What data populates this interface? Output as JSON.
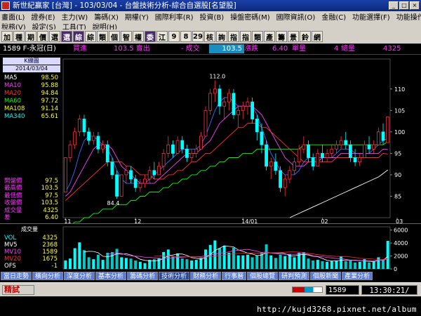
{
  "window": {
    "title": "新世紀贏家 [台灣] - 103/03/04 - 台盤技術分析-綜合自選股[名望股]"
  },
  "menubar": {
    "row1": [
      "畫面(L)",
      "證券(E)",
      "主力(W)",
      "籌碼(X)",
      "期權(Y)",
      "國際利率(R)",
      "投資(B)",
      "操盤密碼(M)",
      "國際資訊(O)",
      "金融(C)",
      "功能選擇(F)",
      "功能操作(P)"
    ],
    "row2": [
      "稅務(V)",
      "設定(S)",
      "工具(T)",
      "說明(H)"
    ]
  },
  "toolbar": {
    "buttons": [
      "加",
      "種",
      "期",
      "價",
      "選",
      "選",
      "綜",
      "綜",
      "類",
      "個",
      "智",
      "權",
      "委",
      "江",
      "9",
      "8",
      "29",
      "核",
      "詢",
      "指",
      "指",
      "類",
      "產",
      "籌",
      "景",
      "鈴",
      "網"
    ],
    "highlight_index": [
      5,
      6,
      12
    ]
  },
  "quote": {
    "stock": "1589 F-永冠(日)",
    "buy_label": "買進",
    "buy_value": "",
    "sell_label": "103.5 賣出",
    "change_label": "- 成交",
    "last_value": "103.5",
    "change_text": "漲跌",
    "change_value": "6.40",
    "unit_label": "單量",
    "unit_value": "4",
    "total_label": "總量",
    "total_value": "4325"
  },
  "indicator_panel": {
    "kline_label": "K線圖",
    "date": "2014/03/04",
    "mas": [
      {
        "name": "MA5",
        "value": "98.50",
        "color": "#ffffff"
      },
      {
        "name": "MA10",
        "value": "95.88",
        "color": "#ff3cff"
      },
      {
        "name": "MA20",
        "value": "94.84",
        "color": "#ff3030"
      },
      {
        "name": "MA60",
        "value": "97.72",
        "color": "#00ff00"
      },
      {
        "name": "MA108",
        "value": "91.14",
        "color": "#ffff00"
      },
      {
        "name": "MA340",
        "value": "65.61",
        "color": "#00ffff"
      }
    ],
    "prices": [
      {
        "name": "開盤價",
        "value": "97.5"
      },
      {
        "name": "最高價",
        "value": "103.5"
      },
      {
        "name": "最低價",
        "value": "97.5"
      },
      {
        "name": "收盤價",
        "value": "103.5"
      },
      {
        "name": "成交量",
        "value": "4325"
      },
      {
        "name": "差",
        "value": "6.40"
      }
    ]
  },
  "chart_data": {
    "type": "candlestick",
    "ylim": [
      80,
      117
    ],
    "yticks": [
      85,
      90,
      95,
      100,
      105,
      110
    ],
    "xticks": [
      {
        "index": 0,
        "label": "11"
      },
      {
        "index": 15,
        "label": "12"
      },
      {
        "index": 38,
        "label": "14/01"
      },
      {
        "index": 55,
        "label": "02"
      },
      {
        "index": 71,
        "label": "03"
      }
    ],
    "max_label": "112.0",
    "min_label": "84.4",
    "candles": [
      [
        86,
        94,
        86,
        94
      ],
      [
        94,
        98,
        93,
        97
      ],
      [
        97,
        101,
        96,
        100
      ],
      [
        100,
        104,
        99,
        103
      ],
      [
        103,
        104,
        99,
        100
      ],
      [
        100,
        101,
        97,
        98
      ],
      [
        98,
        100,
        97,
        99
      ],
      [
        99,
        100,
        95,
        96
      ],
      [
        96,
        98,
        95,
        97
      ],
      [
        97,
        98,
        92,
        93
      ],
      [
        93,
        94,
        89,
        90
      ],
      [
        90,
        91,
        84.4,
        85
      ],
      [
        85,
        90,
        85,
        90
      ],
      [
        90,
        92,
        88,
        91
      ],
      [
        91,
        92,
        88,
        89
      ],
      [
        89,
        90,
        86,
        87
      ],
      [
        87,
        89,
        86,
        88
      ],
      [
        88,
        90,
        87,
        89
      ],
      [
        89,
        92,
        88,
        91
      ],
      [
        91,
        93,
        89,
        90
      ],
      [
        90,
        93,
        90,
        92
      ],
      [
        92,
        96,
        91,
        95
      ],
      [
        95,
        99,
        94,
        97
      ],
      [
        97,
        98,
        94,
        95
      ],
      [
        95,
        99,
        95,
        98
      ],
      [
        98,
        99,
        95,
        96
      ],
      [
        96,
        97,
        93,
        94
      ],
      [
        94,
        96,
        93,
        95
      ],
      [
        95,
        97,
        94,
        96
      ],
      [
        96,
        100,
        96,
        99
      ],
      [
        99,
        106,
        99,
        105
      ],
      [
        105,
        110,
        104,
        109
      ],
      [
        109,
        112,
        107,
        110
      ],
      [
        110,
        111,
        104,
        106
      ],
      [
        106,
        108,
        103,
        107
      ],
      [
        107,
        110,
        105,
        109
      ],
      [
        109,
        110,
        103,
        104
      ],
      [
        104,
        106,
        101,
        105
      ],
      [
        105,
        107,
        103,
        106
      ],
      [
        106,
        108,
        104,
        107
      ],
      [
        107,
        108,
        102,
        103
      ],
      [
        103,
        104,
        98,
        100
      ],
      [
        100,
        102,
        95,
        97
      ],
      [
        97,
        98,
        91,
        92
      ],
      [
        92,
        94,
        89,
        93
      ],
      [
        93,
        95,
        90,
        91
      ],
      [
        91,
        92,
        86,
        87
      ],
      [
        87,
        90,
        85,
        89
      ],
      [
        89,
        92,
        88,
        91
      ],
      [
        91,
        94,
        90,
        93
      ],
      [
        93,
        97,
        92,
        96
      ],
      [
        96,
        99,
        95,
        97
      ],
      [
        97,
        98,
        93,
        94
      ],
      [
        94,
        95,
        91,
        92
      ],
      [
        92,
        96,
        92,
        95
      ],
      [
        95,
        97,
        93,
        94
      ],
      [
        94,
        96,
        93,
        95
      ],
      [
        95,
        97,
        94,
        96
      ],
      [
        96,
        98,
        95,
        97
      ],
      [
        97,
        99,
        96,
        98
      ],
      [
        98,
        100,
        96,
        97
      ],
      [
        97,
        98,
        93,
        94
      ],
      [
        94,
        96,
        92,
        93
      ],
      [
        93,
        95,
        92,
        94
      ],
      [
        94,
        98,
        94,
        97
      ],
      [
        97,
        99,
        95,
        96
      ],
      [
        96,
        98,
        95,
        97
      ],
      [
        97,
        101,
        97,
        100
      ],
      [
        100,
        102,
        97,
        98
      ],
      [
        97.5,
        103.5,
        97.5,
        103.5
      ]
    ],
    "ma_lines": {
      "ma5": [
        86,
        88,
        91,
        95,
        98,
        99,
        99,
        98,
        97,
        96,
        94,
        91,
        89,
        88,
        88,
        88,
        88,
        88,
        89,
        90,
        91,
        92,
        93,
        94,
        95,
        96,
        96,
        96,
        96,
        97,
        99,
        102,
        105,
        107,
        108,
        108,
        107,
        106,
        106,
        106,
        106,
        104,
        101,
        98,
        95,
        93,
        91,
        90,
        90,
        90,
        91,
        93,
        94,
        94,
        94,
        94,
        94,
        94,
        95,
        96,
        96,
        96,
        95,
        95,
        95,
        95,
        96,
        97,
        98,
        98.5
      ],
      "ma10": [
        85,
        86,
        88,
        90,
        92,
        94,
        96,
        97,
        97,
        97,
        96,
        94,
        92,
        91,
        90,
        89,
        88,
        88,
        88,
        88,
        89,
        90,
        91,
        92,
        93,
        94,
        95,
        95,
        95,
        96,
        97,
        98,
        100,
        102,
        103,
        104,
        105,
        106,
        106,
        106,
        106,
        105,
        104,
        102,
        100,
        98,
        96,
        94,
        93,
        92,
        92,
        92,
        93,
        93,
        93,
        94,
        94,
        94,
        94,
        95,
        95,
        95,
        95,
        95,
        95,
        95,
        95,
        95,
        96,
        95.88
      ],
      "ma20": [
        84,
        85,
        86,
        87,
        88,
        89,
        90,
        91,
        92,
        93,
        93,
        93,
        93,
        92,
        92,
        91,
        90,
        90,
        90,
        89,
        89,
        89,
        90,
        90,
        91,
        91,
        92,
        93,
        93,
        94,
        95,
        95,
        96,
        97,
        98,
        99,
        100,
        101,
        101,
        102,
        102,
        102,
        101,
        101,
        100,
        99,
        98,
        97,
        96,
        95,
        94,
        93,
        93,
        93,
        93,
        93,
        93,
        93,
        94,
        94,
        94,
        94,
        94,
        94,
        94,
        94,
        94,
        94,
        95,
        94.84
      ],
      "ma60": [
        78,
        78,
        79,
        79,
        80,
        80,
        81,
        81,
        82,
        82,
        82,
        83,
        83,
        83,
        84,
        84,
        85,
        85,
        86,
        86,
        86,
        87,
        87,
        88,
        88,
        89,
        89,
        90,
        90,
        91,
        91,
        92,
        92,
        93,
        93,
        94,
        94,
        94,
        95,
        95,
        95,
        96,
        96,
        96,
        96,
        96,
        96,
        96,
        96,
        96,
        96,
        97,
        97,
        97,
        97,
        97,
        97,
        97,
        97,
        97,
        97,
        97,
        97,
        97,
        97,
        97,
        97,
        97,
        97,
        97.72
      ],
      "ma108": [
        null,
        null,
        null,
        null,
        null,
        null,
        null,
        null,
        null,
        null,
        null,
        null,
        null,
        null,
        null,
        null,
        null,
        null,
        null,
        null,
        null,
        null,
        null,
        null,
        null,
        null,
        null,
        null,
        null,
        null,
        null,
        null,
        null,
        null,
        null,
        null,
        null,
        null,
        null,
        null,
        null,
        null,
        null,
        null,
        null,
        null,
        null,
        null,
        80,
        80.5,
        81,
        81.5,
        82,
        82.5,
        83,
        83.5,
        84,
        84.5,
        85,
        85.5,
        86,
        86.5,
        87,
        87.5,
        88,
        88.5,
        89,
        89.5,
        90.3,
        91.14
      ]
    },
    "volume": {
      "yticks": [
        0,
        2000,
        4000,
        6000
      ],
      "ymax": 6500,
      "bars": [
        1300,
        1600,
        3200,
        4100,
        2900,
        1800,
        1500,
        2200,
        1400,
        2500,
        2600,
        3100,
        1800,
        1700,
        1600,
        1300,
        1100,
        900,
        1400,
        1500,
        1700,
        2600,
        3000,
        1900,
        2400,
        1600,
        1500,
        1300,
        1400,
        1700,
        3000,
        3700,
        4400,
        3200,
        3600,
        2500,
        3300,
        2100,
        2100,
        2200,
        1800,
        2100,
        2600,
        3800,
        2100,
        1700,
        2200,
        2000,
        2300,
        1800,
        2500,
        2600,
        1600,
        1300,
        1400,
        1200,
        1100,
        1200,
        1300,
        1900,
        1200,
        1300,
        1000,
        1100,
        1500,
        1000,
        1100,
        1800,
        1400,
        4325
      ]
    },
    "volume_panel": {
      "label": "成交量",
      "rows": [
        {
          "name": "VOL",
          "value": "4325",
          "color": "#00ffff"
        },
        {
          "name": "MV5",
          "value": "2368",
          "color": "#ffffff"
        },
        {
          "name": "MV10",
          "value": "1589",
          "color": "#ff3cff"
        },
        {
          "name": "MV20",
          "value": "1675",
          "color": "#ff3030"
        },
        {
          "name": "OFS",
          "value": "-1",
          "color": "#ffffff"
        }
      ]
    }
  },
  "tabs": [
    "當日走勢",
    "橫向分析",
    "深度分析",
    "基本分析",
    "籌碼分析",
    "技術分析",
    "財務分析",
    "行事曆",
    "個股總覽",
    "研判預測",
    "個股新聞",
    "產業分析"
  ],
  "active_tab": 5,
  "status": {
    "mode": "精試",
    "stock_code": "1589",
    "time": "13:30:21/"
  },
  "footer": {
    "url": "http://kujd3268.pixnet.net/album"
  }
}
